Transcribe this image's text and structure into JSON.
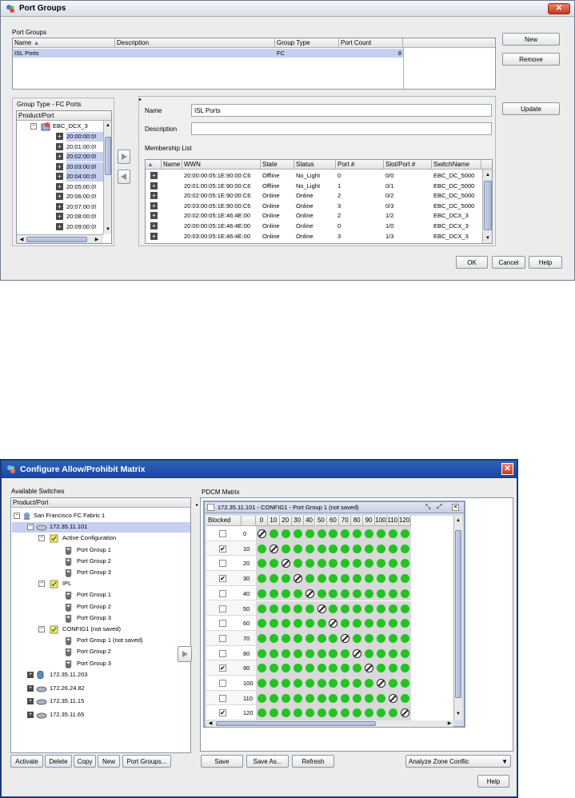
{
  "dialog1": {
    "title": "Port Groups",
    "section_label": "Port Groups",
    "groups_table": {
      "columns": [
        "Name",
        "Description",
        "Group Type",
        "Port Count"
      ],
      "rows": [
        [
          "ISL Ports",
          "",
          "FC",
          "8"
        ]
      ]
    },
    "buttons": {
      "new": "New",
      "remove": "Remove",
      "update": "Update",
      "ok": "OK",
      "cancel": "Cancel",
      "help": "Help"
    },
    "group_type_label": "Group Type - FC Ports",
    "tree_header": "Product/Port",
    "tree_root": "EBC_DCX_3",
    "tree_ports": [
      "20:00:00:0!",
      "20:01:00:0!",
      "20:02:00:0!",
      "20:03:00:0!",
      "20:04:00:0!",
      "20:05:00:0!",
      "20:06:00:0!",
      "20:07:00:0!",
      "20:08:00:0!",
      "20:09:00:0!"
    ],
    "name_label": "Name",
    "name_value": "ISL Ports",
    "description_label": "Description",
    "description_value": "",
    "membership_label": "Membership List",
    "membership_table": {
      "columns": [
        "Name",
        "WWN",
        "State",
        "Status",
        "Port #",
        "Slot/Port #",
        "SwitchName"
      ],
      "rows": [
        [
          "",
          "20:00:00:05:1E:90:00:C6",
          "Offline",
          "No_Light",
          "0",
          "0/0",
          "EBC_DC_5000"
        ],
        [
          "",
          "20:01:00:05:1E:90:00:C6",
          "Offline",
          "No_Light",
          "1",
          "0/1",
          "EBC_DC_5000"
        ],
        [
          "",
          "20:02:00:05:1E:90:00:C6",
          "Online",
          "Online",
          "2",
          "0/2",
          "EBC_DC_5000"
        ],
        [
          "",
          "20:03:00:05:1E:90:00:C6",
          "Online",
          "Online",
          "3",
          "0/3",
          "EBC_DC_5000"
        ],
        [
          "",
          "20:02:00:05:1E:46:4E:00",
          "Online",
          "Online",
          "2",
          "1/2",
          "EBC_DCX_3"
        ],
        [
          "",
          "20:00:00:05:1E:46:4E:00",
          "Online",
          "Online",
          "0",
          "1/0",
          "EBC_DCX_3"
        ],
        [
          "",
          "20:03:00:05:1E:46:4E:00",
          "Online",
          "Online",
          "3",
          "1/3",
          "EBC_DCX_3"
        ]
      ]
    }
  },
  "dialog2": {
    "title": "Configure Allow/Prohibit Matrix",
    "available_label": "Available Switches",
    "tree_header": "Product/Port",
    "fabric": "San Francisco FC Fabric 1",
    "switch_selected": "172.35.11.101",
    "configs": [
      {
        "name": "Active Configuration",
        "groups": [
          "Port Group 1",
          "Port Group 2",
          "Port Group 3"
        ]
      },
      {
        "name": "IPL",
        "groups": [
          "Port Group 1",
          "Port Group 2",
          "Port Group 3"
        ]
      },
      {
        "name": "CONFIG1 (not saved)",
        "groups": [
          "Port Group 1 (not saved)",
          "Port Group 2",
          "Port Group 3"
        ]
      }
    ],
    "other_switches": [
      "172.35.11.203",
      "172.26.24.82",
      "172.35.11.15",
      "172.35.11.65"
    ],
    "left_buttons": [
      "Activate",
      "Delete",
      "Copy",
      "New",
      "Port Groups..."
    ],
    "pdcm_label": "PDCM Matrix",
    "matrix_title": "172.35.11.101 - CONFIG1 - Port Group 1 (not saved)",
    "blocked_header": "Blocked",
    "col_headers": [
      "0",
      "10",
      "20",
      "30",
      "40",
      "50",
      "60",
      "70",
      "80",
      "90",
      "100",
      "110",
      "120"
    ],
    "row_headers": [
      "0",
      "10",
      "20",
      "30",
      "40",
      "50",
      "60",
      "70",
      "80",
      "90",
      "100",
      "110",
      "120"
    ],
    "blocked": [
      false,
      true,
      false,
      true,
      false,
      false,
      false,
      false,
      false,
      true,
      false,
      false,
      true
    ],
    "bottom_buttons": {
      "save": "Save",
      "save_as": "Save As...",
      "refresh": "Refresh",
      "help": "Help"
    },
    "analyze_select": "Analyze Zone Conflic"
  }
}
